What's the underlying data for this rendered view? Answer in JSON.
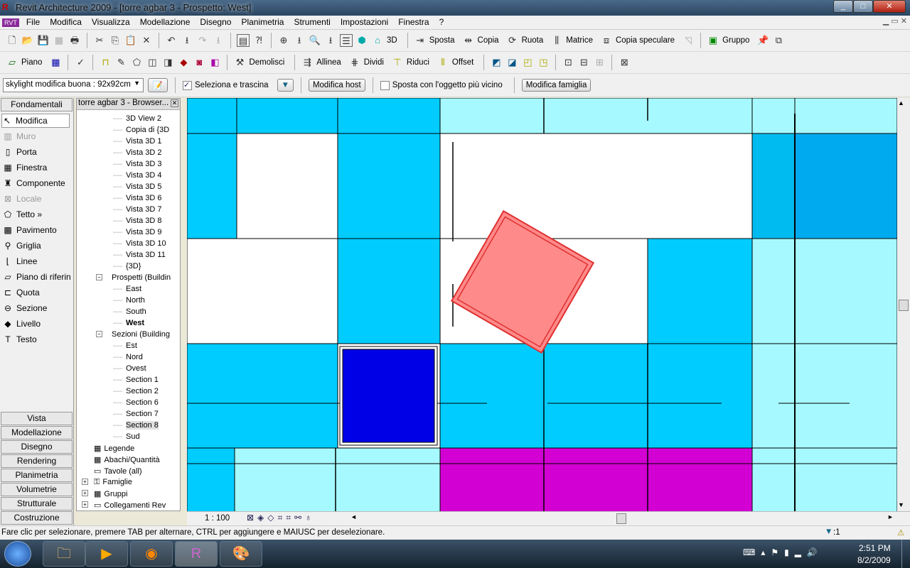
{
  "window": {
    "title": "Revit Architecture 2009 - [torre agbar 3 - Prospetto: West]"
  },
  "menu": [
    "File",
    "Modifica",
    "Visualizza",
    "Modellazione",
    "Disegno",
    "Planimetria",
    "Strumenti",
    "Impostazioni",
    "Finestra",
    "?"
  ],
  "toolbar1": {
    "view3d": "3D",
    "sposta": "Sposta",
    "copia": "Copia",
    "ruota": "Ruota",
    "matrice": "Matrice",
    "copia_speculare": "Copia speculare",
    "gruppo": "Gruppo"
  },
  "toolbar2": {
    "piano": "Piano",
    "demolisci": "Demolisci",
    "allinea": "Allinea",
    "dividi": "Dividi",
    "riduci": "Riduci",
    "offset": "Offset"
  },
  "options": {
    "type_selector": "skylight modifica buona : 92x92cm",
    "drag_checkbox": "Seleziona e trascina",
    "drag_checked": true,
    "edit_host": "Modifica host",
    "move_nearest": "Sposta con l'oggetto più vicino",
    "move_nearest_checked": false,
    "edit_family": "Modifica famiglia"
  },
  "designbar": {
    "header": "Fondamentali",
    "items": [
      {
        "label": "Modifica",
        "icon": "arrow-cursor-icon",
        "enabled": true,
        "active": true
      },
      {
        "label": "Muro",
        "icon": "wall-icon",
        "enabled": false
      },
      {
        "label": "Porta",
        "icon": "door-icon",
        "enabled": true
      },
      {
        "label": "Finestra",
        "icon": "window-icon",
        "enabled": true
      },
      {
        "label": "Componente",
        "icon": "component-icon",
        "enabled": true
      },
      {
        "label": "Locale",
        "icon": "room-icon",
        "enabled": false
      },
      {
        "label": "Tetto »",
        "icon": "roof-icon",
        "enabled": true
      },
      {
        "label": "Pavimento",
        "icon": "floor-icon",
        "enabled": true
      },
      {
        "label": "Griglia",
        "icon": "grid-icon",
        "enabled": true
      },
      {
        "label": "Linee",
        "icon": "lines-icon",
        "enabled": true
      },
      {
        "label": "Piano di riferin",
        "icon": "ref-plane-icon",
        "enabled": true
      },
      {
        "label": "Quota",
        "icon": "dimension-icon",
        "enabled": true
      },
      {
        "label": "Sezione",
        "icon": "section-icon",
        "enabled": true
      },
      {
        "label": "Livello",
        "icon": "level-icon",
        "enabled": true
      },
      {
        "label": "Testo",
        "icon": "text-icon",
        "enabled": true
      }
    ],
    "tabs": [
      "Vista",
      "Modellazione",
      "Disegno",
      "Rendering",
      "Planimetria",
      "Volumetrie",
      "Strutturale",
      "Costruzione"
    ]
  },
  "browser": {
    "title": "torre agbar 3 - Browser...",
    "nodes": [
      {
        "label": "3D View 2",
        "level": 2
      },
      {
        "label": "Copia di {3D",
        "level": 2
      },
      {
        "label": "Vista 3D 1",
        "level": 2
      },
      {
        "label": "Vista 3D 2",
        "level": 2
      },
      {
        "label": "Vista 3D 3",
        "level": 2
      },
      {
        "label": "Vista 3D 4",
        "level": 2
      },
      {
        "label": "Vista 3D 5",
        "level": 2
      },
      {
        "label": "Vista 3D 6",
        "level": 2
      },
      {
        "label": "Vista 3D 7",
        "level": 2
      },
      {
        "label": "Vista 3D 8",
        "level": 2
      },
      {
        "label": "Vista 3D 9",
        "level": 2
      },
      {
        "label": "Vista 3D 10",
        "level": 2
      },
      {
        "label": "Vista 3D 11",
        "level": 2
      },
      {
        "label": "{3D}",
        "level": 2
      },
      {
        "label": "Prospetti (Buildin",
        "level": 1,
        "expander": "−"
      },
      {
        "label": "East",
        "level": 2
      },
      {
        "label": "North",
        "level": 2
      },
      {
        "label": "South",
        "level": 2
      },
      {
        "label": "West",
        "level": 2,
        "bold": true
      },
      {
        "label": "Sezioni (Building",
        "level": 1,
        "expander": "−"
      },
      {
        "label": "Est",
        "level": 2
      },
      {
        "label": "Nord",
        "level": 2
      },
      {
        "label": "Ovest",
        "level": 2
      },
      {
        "label": "Section 1",
        "level": 2
      },
      {
        "label": "Section 2",
        "level": 2
      },
      {
        "label": "Section 6",
        "level": 2
      },
      {
        "label": "Section 7",
        "level": 2
      },
      {
        "label": "Section 8",
        "level": 2,
        "selected": true
      },
      {
        "label": "Sud",
        "level": 2
      },
      {
        "label": "Legende",
        "level": 0
      },
      {
        "label": "Abachi/Quantità",
        "level": 0
      },
      {
        "label": "Tavole (all)",
        "level": 0
      },
      {
        "label": "Famiglie",
        "level": 0,
        "expander": "+"
      },
      {
        "label": "Gruppi",
        "level": 0,
        "expander": "+"
      },
      {
        "label": "Collegamenti Rev",
        "level": 0,
        "expander": "+"
      }
    ]
  },
  "viewbar": {
    "scale": "1 : 100"
  },
  "status": {
    "message": "Fare clic per selezionare, premere TAB per alternare, CTRL per aggiungere e MAIUSC per deselezionare.",
    "filter_count": ":1"
  },
  "colors": {
    "cyan": "#00ccff",
    "light_cyan": "#a6faff",
    "deep_blue": "#0000e6",
    "magenta": "#d200d2",
    "pink": "#ff8a8a"
  },
  "taskbar": {
    "time": "2:51 PM",
    "date": "8/2/2009"
  }
}
